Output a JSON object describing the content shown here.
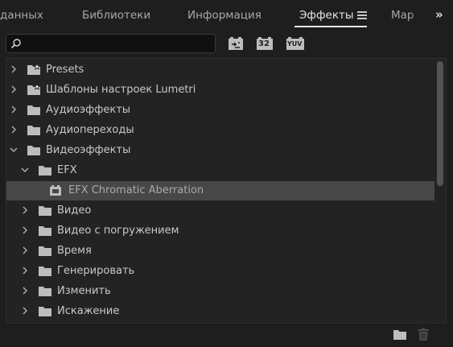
{
  "tabs": [
    {
      "label": "данных"
    },
    {
      "label": "Библиотеки"
    },
    {
      "label": "Информация"
    },
    {
      "label": "Эффекты",
      "active": true
    },
    {
      "label": "Мар"
    }
  ],
  "overflow_label": "»",
  "search": {
    "value": "",
    "placeholder": ""
  },
  "filters": [
    {
      "icon": "accelerated-effects-icon",
      "label": ""
    },
    {
      "icon": "32-bit-color-icon",
      "label": "32"
    },
    {
      "icon": "yuv-effects-icon",
      "label": "YUV"
    }
  ],
  "tree": [
    {
      "label": "Presets",
      "level": 0,
      "state": "collapsed",
      "icon": "star-folder-icon"
    },
    {
      "label": "Шаблоны настроек Lumetri",
      "level": 0,
      "state": "collapsed",
      "icon": "star-folder-icon"
    },
    {
      "label": "Аудиоэффекты",
      "level": 0,
      "state": "collapsed",
      "icon": "folder-icon"
    },
    {
      "label": "Аудиопереходы",
      "level": 0,
      "state": "collapsed",
      "icon": "folder-icon"
    },
    {
      "label": "Видеоэффекты",
      "level": 0,
      "state": "expanded",
      "icon": "folder-icon"
    },
    {
      "label": "EFX",
      "level": 1,
      "state": "expanded",
      "icon": "folder-icon"
    },
    {
      "label": "EFX Chromatic Aberration",
      "level": 2,
      "state": "leaf",
      "icon": "effect-icon",
      "selected": true
    },
    {
      "label": "Видео",
      "level": 1,
      "state": "collapsed",
      "icon": "folder-icon"
    },
    {
      "label": "Видео с погружением",
      "level": 1,
      "state": "collapsed",
      "icon": "folder-icon"
    },
    {
      "label": "Время",
      "level": 1,
      "state": "collapsed",
      "icon": "folder-icon"
    },
    {
      "label": "Генерировать",
      "level": 1,
      "state": "collapsed",
      "icon": "folder-icon"
    },
    {
      "label": "Изменить",
      "level": 1,
      "state": "collapsed",
      "icon": "folder-icon"
    },
    {
      "label": "Искажение",
      "level": 1,
      "state": "collapsed",
      "icon": "folder-icon"
    }
  ],
  "footer": [
    {
      "icon": "new-bin-icon"
    },
    {
      "icon": "trash-icon"
    }
  ],
  "colors": {
    "background": "#1e1e1e",
    "list": "#232323",
    "selected_row": "#474747",
    "text": "#c8c8c8"
  }
}
